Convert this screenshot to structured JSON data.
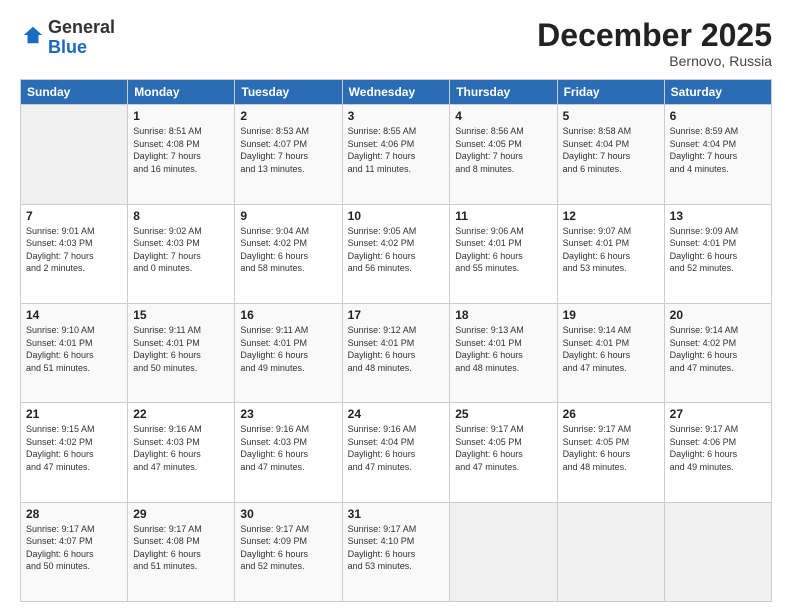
{
  "header": {
    "logo_general": "General",
    "logo_blue": "Blue",
    "month_title": "December 2025",
    "location": "Bernovo, Russia"
  },
  "weekdays": [
    "Sunday",
    "Monday",
    "Tuesday",
    "Wednesday",
    "Thursday",
    "Friday",
    "Saturday"
  ],
  "weeks": [
    [
      {
        "day": "",
        "info": ""
      },
      {
        "day": "1",
        "info": "Sunrise: 8:51 AM\nSunset: 4:08 PM\nDaylight: 7 hours\nand 16 minutes."
      },
      {
        "day": "2",
        "info": "Sunrise: 8:53 AM\nSunset: 4:07 PM\nDaylight: 7 hours\nand 13 minutes."
      },
      {
        "day": "3",
        "info": "Sunrise: 8:55 AM\nSunset: 4:06 PM\nDaylight: 7 hours\nand 11 minutes."
      },
      {
        "day": "4",
        "info": "Sunrise: 8:56 AM\nSunset: 4:05 PM\nDaylight: 7 hours\nand 8 minutes."
      },
      {
        "day": "5",
        "info": "Sunrise: 8:58 AM\nSunset: 4:04 PM\nDaylight: 7 hours\nand 6 minutes."
      },
      {
        "day": "6",
        "info": "Sunrise: 8:59 AM\nSunset: 4:04 PM\nDaylight: 7 hours\nand 4 minutes."
      }
    ],
    [
      {
        "day": "7",
        "info": "Sunrise: 9:01 AM\nSunset: 4:03 PM\nDaylight: 7 hours\nand 2 minutes."
      },
      {
        "day": "8",
        "info": "Sunrise: 9:02 AM\nSunset: 4:03 PM\nDaylight: 7 hours\nand 0 minutes."
      },
      {
        "day": "9",
        "info": "Sunrise: 9:04 AM\nSunset: 4:02 PM\nDaylight: 6 hours\nand 58 minutes."
      },
      {
        "day": "10",
        "info": "Sunrise: 9:05 AM\nSunset: 4:02 PM\nDaylight: 6 hours\nand 56 minutes."
      },
      {
        "day": "11",
        "info": "Sunrise: 9:06 AM\nSunset: 4:01 PM\nDaylight: 6 hours\nand 55 minutes."
      },
      {
        "day": "12",
        "info": "Sunrise: 9:07 AM\nSunset: 4:01 PM\nDaylight: 6 hours\nand 53 minutes."
      },
      {
        "day": "13",
        "info": "Sunrise: 9:09 AM\nSunset: 4:01 PM\nDaylight: 6 hours\nand 52 minutes."
      }
    ],
    [
      {
        "day": "14",
        "info": "Sunrise: 9:10 AM\nSunset: 4:01 PM\nDaylight: 6 hours\nand 51 minutes."
      },
      {
        "day": "15",
        "info": "Sunrise: 9:11 AM\nSunset: 4:01 PM\nDaylight: 6 hours\nand 50 minutes."
      },
      {
        "day": "16",
        "info": "Sunrise: 9:11 AM\nSunset: 4:01 PM\nDaylight: 6 hours\nand 49 minutes."
      },
      {
        "day": "17",
        "info": "Sunrise: 9:12 AM\nSunset: 4:01 PM\nDaylight: 6 hours\nand 48 minutes."
      },
      {
        "day": "18",
        "info": "Sunrise: 9:13 AM\nSunset: 4:01 PM\nDaylight: 6 hours\nand 48 minutes."
      },
      {
        "day": "19",
        "info": "Sunrise: 9:14 AM\nSunset: 4:01 PM\nDaylight: 6 hours\nand 47 minutes."
      },
      {
        "day": "20",
        "info": "Sunrise: 9:14 AM\nSunset: 4:02 PM\nDaylight: 6 hours\nand 47 minutes."
      }
    ],
    [
      {
        "day": "21",
        "info": "Sunrise: 9:15 AM\nSunset: 4:02 PM\nDaylight: 6 hours\nand 47 minutes."
      },
      {
        "day": "22",
        "info": "Sunrise: 9:16 AM\nSunset: 4:03 PM\nDaylight: 6 hours\nand 47 minutes."
      },
      {
        "day": "23",
        "info": "Sunrise: 9:16 AM\nSunset: 4:03 PM\nDaylight: 6 hours\nand 47 minutes."
      },
      {
        "day": "24",
        "info": "Sunrise: 9:16 AM\nSunset: 4:04 PM\nDaylight: 6 hours\nand 47 minutes."
      },
      {
        "day": "25",
        "info": "Sunrise: 9:17 AM\nSunset: 4:05 PM\nDaylight: 6 hours\nand 47 minutes."
      },
      {
        "day": "26",
        "info": "Sunrise: 9:17 AM\nSunset: 4:05 PM\nDaylight: 6 hours\nand 48 minutes."
      },
      {
        "day": "27",
        "info": "Sunrise: 9:17 AM\nSunset: 4:06 PM\nDaylight: 6 hours\nand 49 minutes."
      }
    ],
    [
      {
        "day": "28",
        "info": "Sunrise: 9:17 AM\nSunset: 4:07 PM\nDaylight: 6 hours\nand 50 minutes."
      },
      {
        "day": "29",
        "info": "Sunrise: 9:17 AM\nSunset: 4:08 PM\nDaylight: 6 hours\nand 51 minutes."
      },
      {
        "day": "30",
        "info": "Sunrise: 9:17 AM\nSunset: 4:09 PM\nDaylight: 6 hours\nand 52 minutes."
      },
      {
        "day": "31",
        "info": "Sunrise: 9:17 AM\nSunset: 4:10 PM\nDaylight: 6 hours\nand 53 minutes."
      },
      {
        "day": "",
        "info": ""
      },
      {
        "day": "",
        "info": ""
      },
      {
        "day": "",
        "info": ""
      }
    ]
  ]
}
